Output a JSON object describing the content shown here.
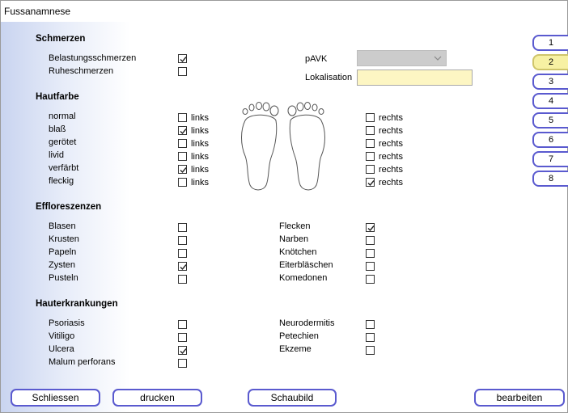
{
  "window": {
    "title": "Fussanamnese"
  },
  "schmerzen": {
    "heading": "Schmerzen",
    "items": [
      {
        "label": "Belastungsschmerzen",
        "checked": true
      },
      {
        "label": "Ruheschmerzen",
        "checked": false
      }
    ],
    "pavk_label": "pAVK",
    "pavk_value": "",
    "lokalisation_label": "Lokalisation",
    "lokalisation_value": ""
  },
  "hautfarbe": {
    "heading": "Hautfarbe",
    "links_label": "links",
    "rechts_label": "rechts",
    "rows": [
      {
        "label": "normal",
        "links": false,
        "rechts": false
      },
      {
        "label": "blaß",
        "links": true,
        "rechts": false
      },
      {
        "label": "gerötet",
        "links": false,
        "rechts": false
      },
      {
        "label": "livid",
        "links": false,
        "rechts": false
      },
      {
        "label": "verfärbt",
        "links": true,
        "rechts": false
      },
      {
        "label": "fleckig",
        "links": false,
        "rechts": true
      }
    ]
  },
  "effloreszenzen": {
    "heading": "Effloreszenzen",
    "left": [
      {
        "label": "Blasen",
        "checked": false
      },
      {
        "label": "Krusten",
        "checked": false
      },
      {
        "label": "Papeln",
        "checked": false
      },
      {
        "label": "Zysten",
        "checked": true
      },
      {
        "label": "Pusteln",
        "checked": false
      }
    ],
    "right": [
      {
        "label": "Flecken",
        "checked": true
      },
      {
        "label": "Narben",
        "checked": false
      },
      {
        "label": "Knötchen",
        "checked": false
      },
      {
        "label": "Eiterbläschen",
        "checked": false
      },
      {
        "label": "Komedonen",
        "checked": false
      }
    ]
  },
  "hauterkrankungen": {
    "heading": "Hauterkrankungen",
    "left": [
      {
        "label": "Psoriasis",
        "checked": false
      },
      {
        "label": "Vitiligo",
        "checked": false
      },
      {
        "label": "Ulcera",
        "checked": true
      },
      {
        "label": "Malum perforans",
        "checked": false
      }
    ],
    "right": [
      {
        "label": "Neurodermitis",
        "checked": false
      },
      {
        "label": "Petechien",
        "checked": false
      },
      {
        "label": "Ekzeme",
        "checked": false
      }
    ]
  },
  "tabs": [
    "1",
    "2",
    "3",
    "4",
    "5",
    "6",
    "7",
    "8"
  ],
  "active_tab": "2",
  "buttons": {
    "schliessen": "Schliessen",
    "drucken": "drucken",
    "schaubild": "Schaubild",
    "bearbeiten": "bearbeiten"
  },
  "colors": {
    "accent_border": "#5a5acf",
    "active_tab_bg": "#f7f1a3",
    "lokalisation_bg": "#fdf6c3",
    "disabled_select_bg": "#cccccc"
  },
  "icons": {
    "checkmark": "check-icon",
    "feet": "feet-outline-icon",
    "dropdown": "chevron-down-icon"
  }
}
